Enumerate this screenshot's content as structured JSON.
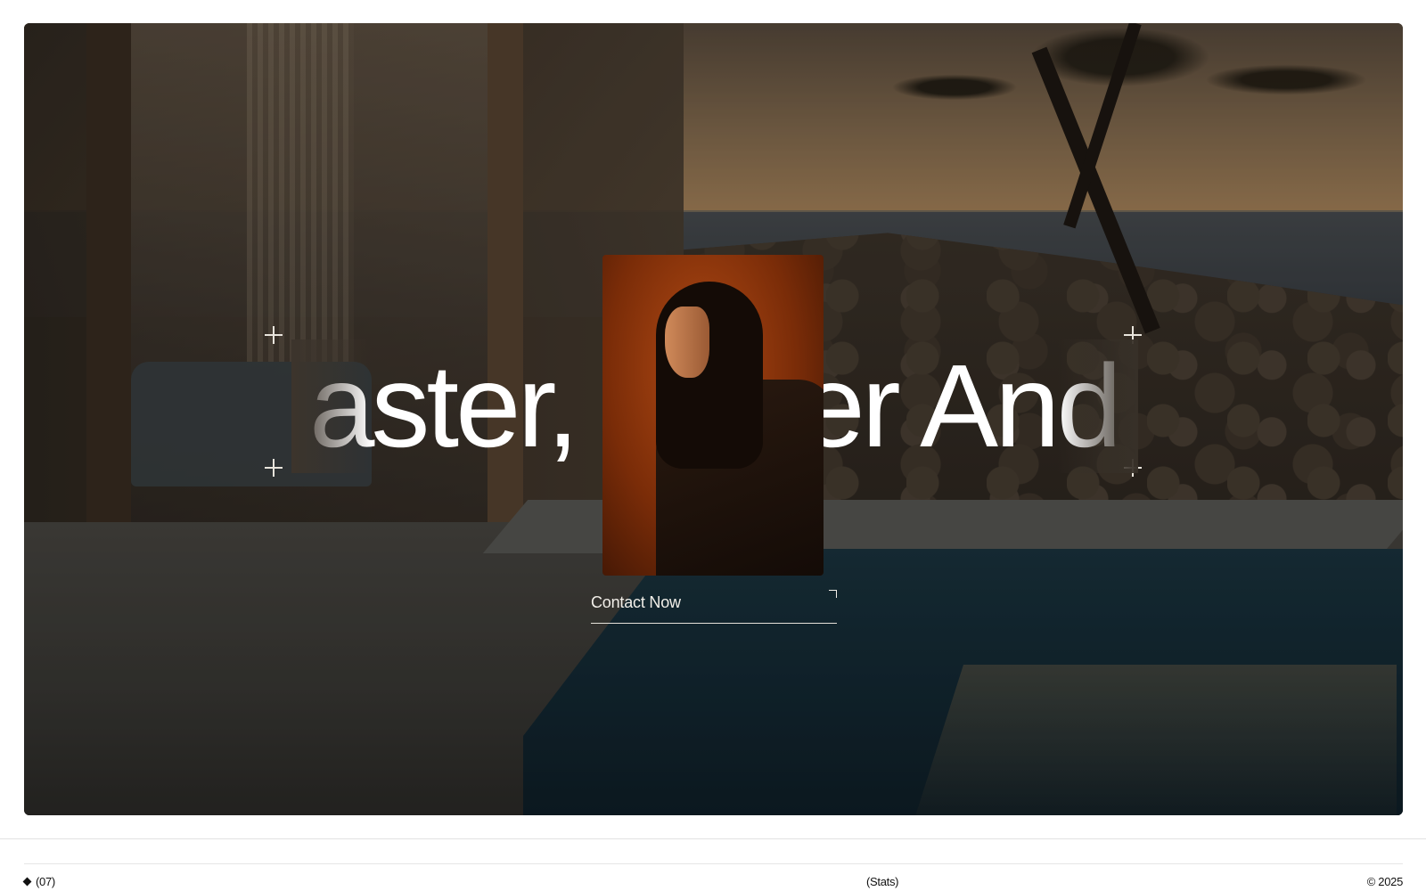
{
  "hero": {
    "headline": "aster, Better And C",
    "contact_label": "Contact Now"
  },
  "footer": {
    "count": "(07)",
    "center_label": "(Stats)",
    "copyright": "© 2025"
  },
  "icons": {
    "crosshair": "plus-crosshair-icon",
    "contact_arrow": "corner-arrow-icon",
    "bullet": "diamond-icon"
  }
}
